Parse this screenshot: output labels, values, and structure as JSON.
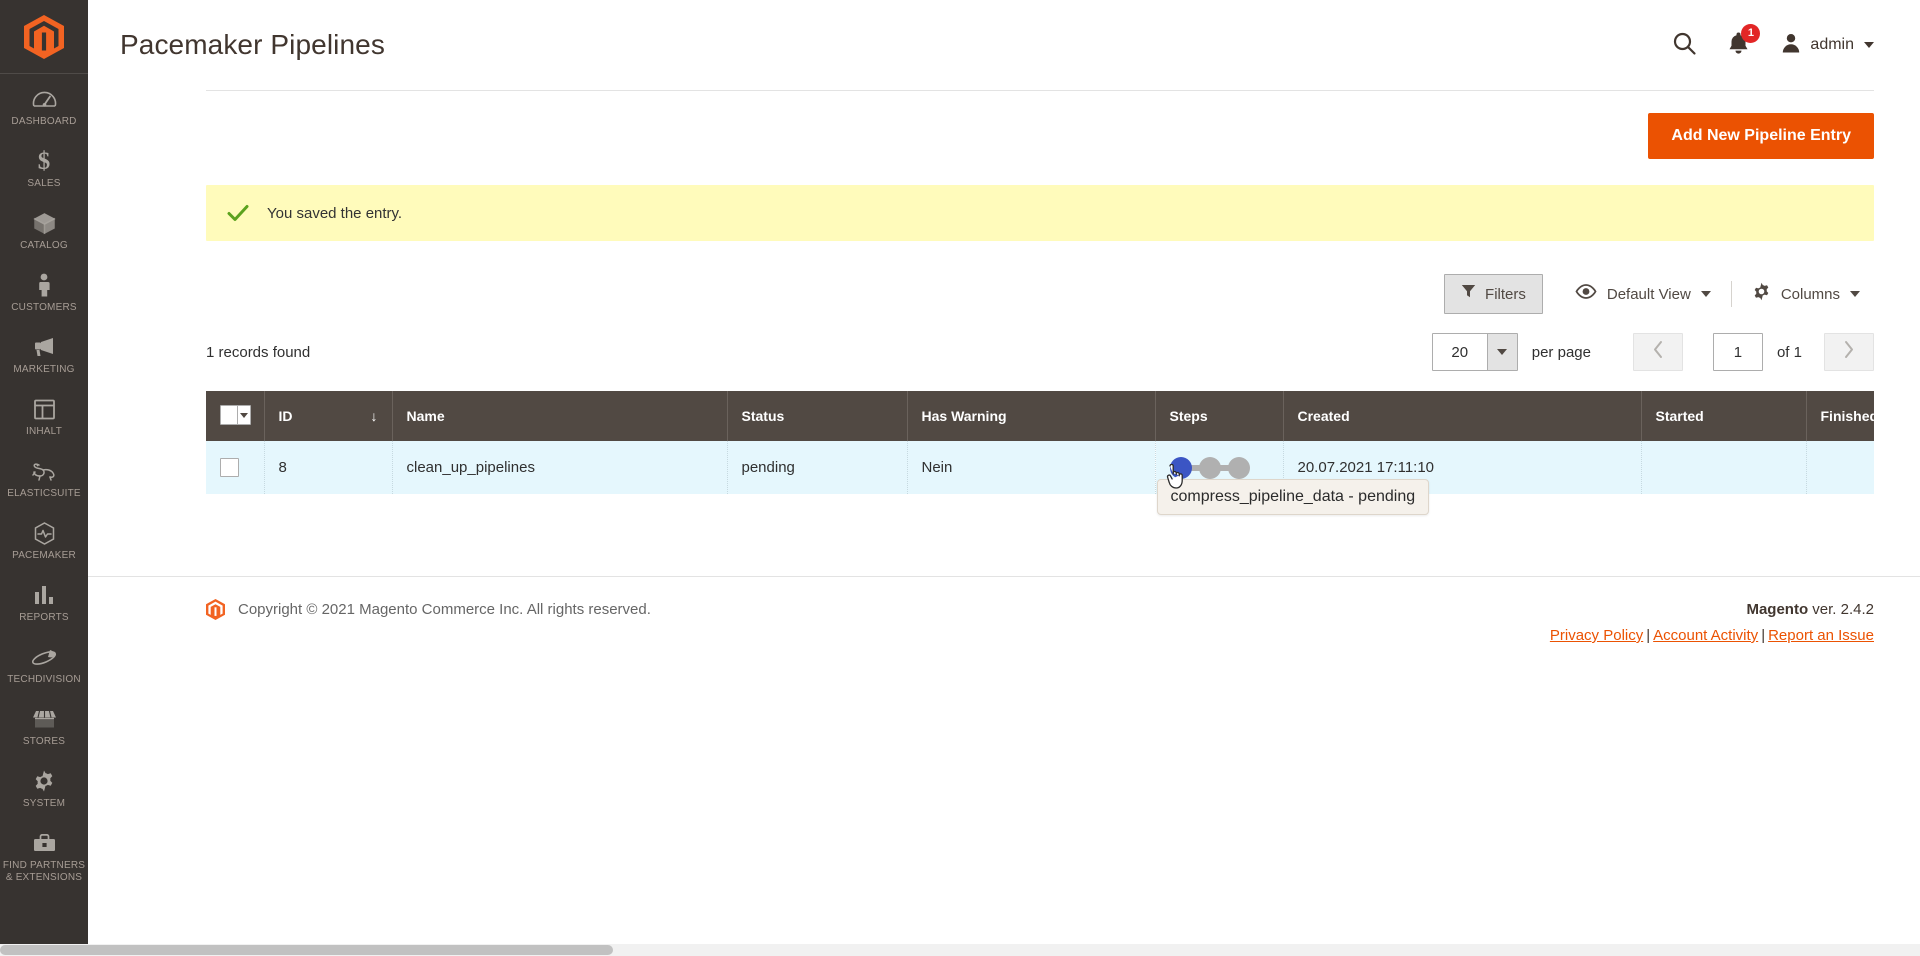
{
  "brand": {
    "accent": "#eb5202",
    "sidebar_bg": "#373330",
    "table_header_bg": "#514943"
  },
  "sidebar": {
    "logo_name": "magento-logo",
    "items": [
      {
        "label": "Dashboard",
        "icon": "dashboard-icon"
      },
      {
        "label": "Sales",
        "icon": "sales-icon"
      },
      {
        "label": "Catalog",
        "icon": "catalog-icon"
      },
      {
        "label": "Customers",
        "icon": "customers-icon"
      },
      {
        "label": "Marketing",
        "icon": "marketing-icon"
      },
      {
        "label": "Inhalt",
        "icon": "content-icon"
      },
      {
        "label": "Elasticsuite",
        "icon": "elasticsuite-rabbit-icon"
      },
      {
        "label": "Pacemaker",
        "icon": "pacemaker-icon"
      },
      {
        "label": "Reports",
        "icon": "reports-icon"
      },
      {
        "label": "Techdivision",
        "icon": "techdivision-icon"
      },
      {
        "label": "Stores",
        "icon": "stores-icon"
      },
      {
        "label": "System",
        "icon": "system-gear-icon"
      },
      {
        "label": "Find Partners\n& Extensions",
        "icon": "find-partners-icon"
      }
    ]
  },
  "header": {
    "title": "Pacemaker Pipelines",
    "search_icon": "search-icon",
    "notifications_icon": "bell-icon",
    "notifications_count": "1",
    "user_icon": "user-avatar-icon",
    "user_name": "admin"
  },
  "page_actions": {
    "add_new_label": "Add New Pipeline Entry"
  },
  "messages": {
    "success_text": "You saved the entry.",
    "success_icon": "checkmark-icon",
    "success_bg": "#fffbbb",
    "success_icon_color": "#5ba21e"
  },
  "grid_toolbar": {
    "filters_label": "Filters",
    "filters_icon": "funnel-icon",
    "view_icon": "eye-icon",
    "view_label": "Default View",
    "columns_icon": "gear-icon",
    "columns_label": "Columns"
  },
  "grid_meta": {
    "records_found": "1 records found",
    "per_page_value": "20",
    "per_page_label": "per page",
    "current_page": "1",
    "of_label": "of 1",
    "prev_icon": "chevron-left-icon",
    "next_icon": "chevron-right-icon"
  },
  "table": {
    "columns": [
      {
        "key": "select",
        "label": ""
      },
      {
        "key": "id",
        "label": "ID",
        "sorted": "desc",
        "sort_glyph": "↓"
      },
      {
        "key": "name",
        "label": "Name"
      },
      {
        "key": "status",
        "label": "Status"
      },
      {
        "key": "has_warning",
        "label": "Has Warning"
      },
      {
        "key": "steps",
        "label": "Steps"
      },
      {
        "key": "created",
        "label": "Created"
      },
      {
        "key": "started",
        "label": "Started"
      },
      {
        "key": "finished",
        "label": "Finished"
      }
    ],
    "rows": [
      {
        "id": "8",
        "name": "clean_up_pipelines",
        "status": "pending",
        "has_warning": "Nein",
        "steps": [
          {
            "state": "active",
            "color": "#3b55c4"
          },
          {
            "state": "inactive",
            "color": "#b0b0b0"
          },
          {
            "state": "inactive",
            "color": "#b0b0b0"
          }
        ],
        "created": "20.07.2021 17:11:10",
        "started": "",
        "finished": ""
      }
    ],
    "row_bg": "#e5f7fd"
  },
  "tooltip": {
    "text": "compress_pipeline_data - pending"
  },
  "footer": {
    "copyright": "Copyright © 2021 Magento Commerce Inc. All rights reserved.",
    "version_brand": "Magento",
    "version_text": " ver. 2.4.2",
    "links": [
      {
        "label": "Privacy Policy"
      },
      {
        "label": "Account Activity"
      },
      {
        "label": "Report an Issue"
      }
    ],
    "separator": "|"
  }
}
